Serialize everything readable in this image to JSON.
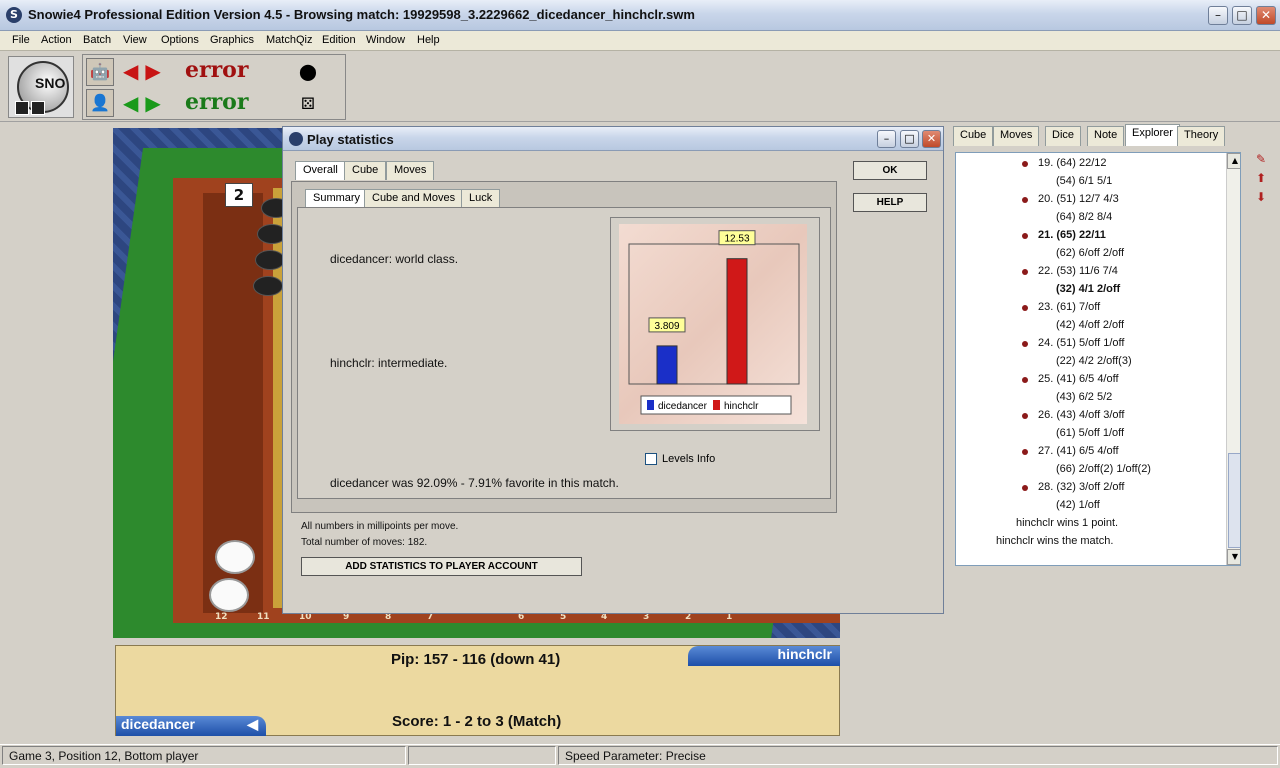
{
  "window": {
    "title": "Snowie4 Professional Edition Version 4.5 - Browsing match: 19929598_3.2229662_dicedancer_hinchclr.swm"
  },
  "menu": {
    "items": [
      "File",
      "Action",
      "Batch",
      "View",
      "Options",
      "Graphics",
      "MatchQiz",
      "Edition",
      "Window",
      "Help"
    ]
  },
  "toolbar": {
    "row1_error": "error",
    "row2_error": "error",
    "logo_text": "SNO"
  },
  "board": {
    "die_value": "2",
    "points": [
      "12",
      "11",
      "10",
      "9",
      "8",
      "7",
      "6",
      "5",
      "4",
      "3",
      "2",
      "1"
    ]
  },
  "info": {
    "pip": "Pip: 157 - 116 (down 41)",
    "score": "Score: 1 - 2 to 3 (Match)",
    "player_top": "hinchclr",
    "player_bottom": "dicedancer",
    "player_bottom_arrow": "◀"
  },
  "status": {
    "cell1": "Game 3, Position 12, Bottom player",
    "cell2": "",
    "cell3": "Speed Parameter: Precise"
  },
  "right_panel": {
    "tabs": [
      "Cube",
      "Moves",
      "Dice",
      "Note",
      "Explorer",
      "Theory"
    ],
    "active_tab": "Explorer",
    "tree": [
      {
        "text": "19. (64) 22/12",
        "bullet": true,
        "bold": false
      },
      {
        "text": "(54) 6/1 5/1",
        "bullet": false,
        "bold": false
      },
      {
        "text": "20. (51) 12/7 4/3",
        "bullet": true,
        "bold": false
      },
      {
        "text": "(64) 8/2 8/4",
        "bullet": false,
        "bold": false
      },
      {
        "text": "21. (65) 22/11",
        "bullet": true,
        "bold": true
      },
      {
        "text": "(62) 6/off 2/off",
        "bullet": false,
        "bold": false
      },
      {
        "text": "22. (53) 11/6 7/4",
        "bullet": true,
        "bold": false
      },
      {
        "text": "(32) 4/1 2/off",
        "bullet": false,
        "bold": true
      },
      {
        "text": "23. (61) 7/off",
        "bullet": true,
        "bold": false
      },
      {
        "text": "(42) 4/off 2/off",
        "bullet": false,
        "bold": false
      },
      {
        "text": "24. (51) 5/off 1/off",
        "bullet": true,
        "bold": false
      },
      {
        "text": "(22) 4/2 2/off(3)",
        "bullet": false,
        "bold": false
      },
      {
        "text": "25. (41) 6/5 4/off",
        "bullet": true,
        "bold": false
      },
      {
        "text": "(43) 6/2 5/2",
        "bullet": false,
        "bold": false
      },
      {
        "text": "26. (43) 4/off 3/off",
        "bullet": true,
        "bold": false
      },
      {
        "text": "(61) 5/off 1/off",
        "bullet": false,
        "bold": false
      },
      {
        "text": "27. (41) 6/5 4/off",
        "bullet": true,
        "bold": false
      },
      {
        "text": "(66) 2/off(2) 1/off(2)",
        "bullet": false,
        "bold": false
      },
      {
        "text": "28. (32) 3/off 2/off",
        "bullet": true,
        "bold": false
      },
      {
        "text": "(42) 1/off",
        "bullet": false,
        "bold": false
      },
      {
        "text": "hinchclr wins 1 point.",
        "bullet": false,
        "bold": false
      },
      {
        "text": "hinchclr wins the match.",
        "bullet": false,
        "bold": false
      }
    ]
  },
  "dialog": {
    "title": "Play statistics",
    "ok": "OK",
    "help": "HELP",
    "outer_tabs": [
      "Overall",
      "Cube",
      "Moves"
    ],
    "inner_tabs": [
      "Summary",
      "Cube and Moves",
      "Luck"
    ],
    "player1_rating": "dicedancer: world class.",
    "player2_rating": "hinchclr: intermediate.",
    "favorite": "dicedancer was 92.09% - 7.91% favorite in this match.",
    "levels_info": "Levels Info",
    "note1": "All numbers in millipoints per move.",
    "note2": "Total number of moves: 182.",
    "add_button": "ADD STATISTICS TO PLAYER ACCOUNT"
  },
  "chart_data": {
    "type": "bar",
    "categories": [
      "dicedancer",
      "hinchclr"
    ],
    "values": [
      3.809,
      12.53
    ],
    "value_labels": [
      "3.809",
      "12.53"
    ],
    "colors": [
      "#1a2fc8",
      "#d01818"
    ],
    "legend": [
      "dicedancer",
      "hinchclr"
    ],
    "legend_position": "bottom",
    "ylim": [
      0,
      14
    ]
  }
}
